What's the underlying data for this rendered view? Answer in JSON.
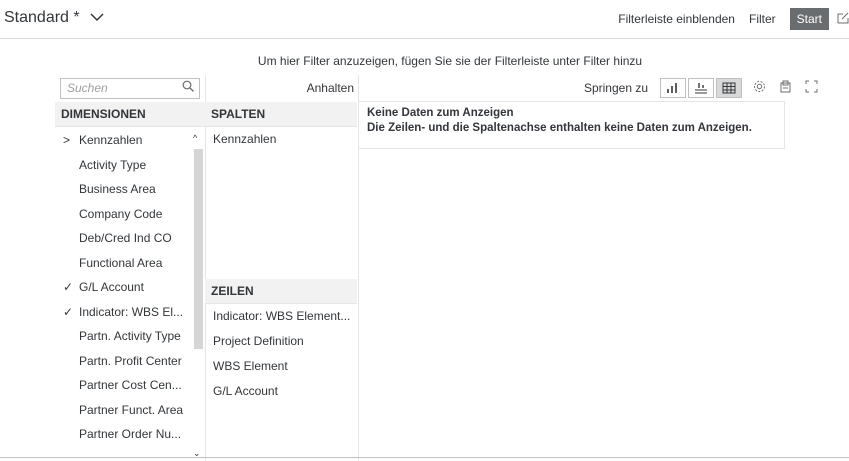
{
  "header": {
    "variant_label": "Standard *",
    "show_filterbar_label": "Filterleiste einblenden",
    "filter_label": "Filter",
    "start_label": "Start"
  },
  "hint": "Um hier Filter anzuzeigen, fügen Sie sie der Filterleiste unter Filter hinzu",
  "dimensions": {
    "search_placeholder": "Suchen",
    "title": "DIMENSIONEN",
    "items": [
      {
        "label": "Kennzahlen",
        "mark": ">"
      },
      {
        "label": "Activity Type",
        "mark": ""
      },
      {
        "label": "Business Area",
        "mark": ""
      },
      {
        "label": "Company Code",
        "mark": ""
      },
      {
        "label": "Deb/Cred Ind CO",
        "mark": ""
      },
      {
        "label": "Functional Area",
        "mark": ""
      },
      {
        "label": "G/L Account",
        "mark": "✓"
      },
      {
        "label": "Indicator: WBS El...",
        "mark": "✓"
      },
      {
        "label": "Partn. Activity Type",
        "mark": ""
      },
      {
        "label": "Partn. Profit Center",
        "mark": ""
      },
      {
        "label": "Partner Cost Cen...",
        "mark": ""
      },
      {
        "label": "Partner Funct. Area",
        "mark": ""
      },
      {
        "label": "Partner Order Nu...",
        "mark": ""
      }
    ]
  },
  "axes": {
    "pause_label": "Anhalten",
    "columns_title": "SPALTEN",
    "columns": [
      "Kennzahlen"
    ],
    "rows_title": "ZEILEN",
    "rows": [
      "Indicator: WBS Element...",
      "Project Definition",
      "WBS Element",
      "G/L Account"
    ]
  },
  "main": {
    "jump_label": "Springen zu",
    "no_data_title": "Keine Daten zum Anzeigen",
    "no_data_text": "Die Zeilen- und die Spaltenachse enthalten keine Daten zum Anzeigen."
  }
}
